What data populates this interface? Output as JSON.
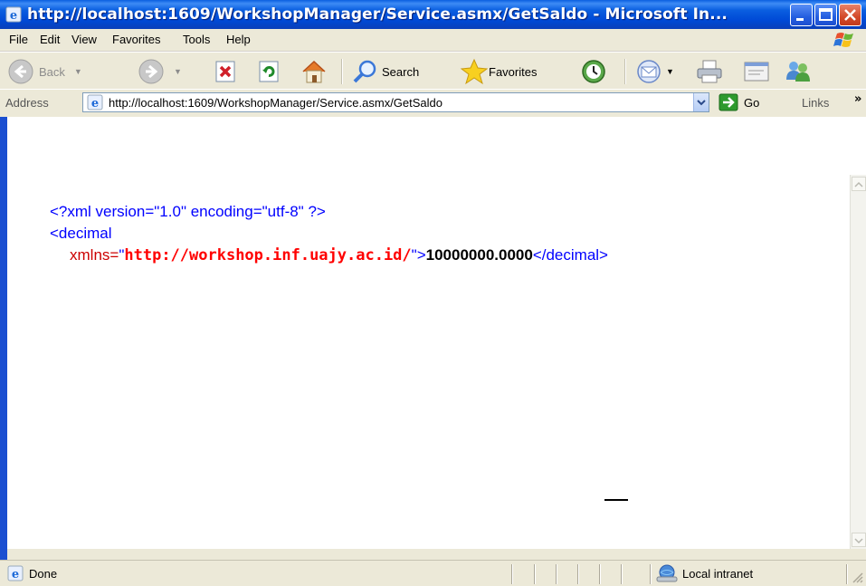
{
  "window": {
    "title": "http://localhost:1609/WorkshopManager/Service.asmx/GetSaldo - Microsoft In...",
    "title_bar_color": "#0a5fe0",
    "close_button_color": "#d34a2a"
  },
  "menu": {
    "items": [
      "File",
      "Edit",
      "View",
      "Favorites",
      "Tools",
      "Help"
    ]
  },
  "toolbar": {
    "back_label": "Back",
    "search_label": "Search",
    "favorites_label": "Favorites"
  },
  "address": {
    "label": "Address",
    "url": "http://localhost:1609/WorkshopManager/Service.asmx/GetSaldo",
    "go_label": "Go",
    "links_label": "Links",
    "more_label": "»"
  },
  "content": {
    "xml_declaration": "<?xml version=\"1.0\" encoding=\"utf-8\" ?>",
    "open_tag": "<decimal",
    "attr_name": "xmlns=",
    "attr_quote_open": "\"",
    "attr_value": "http://workshop.inf.uajy.ac.id/",
    "attr_quote_close": "\"",
    "tag_close": ">",
    "value": "10000000.0000",
    "close_tag": "</decimal>",
    "markup_color": "#0000ff",
    "attribute_color": "#cc0000"
  },
  "status": {
    "text": "Done",
    "zone": "Local intranet"
  }
}
